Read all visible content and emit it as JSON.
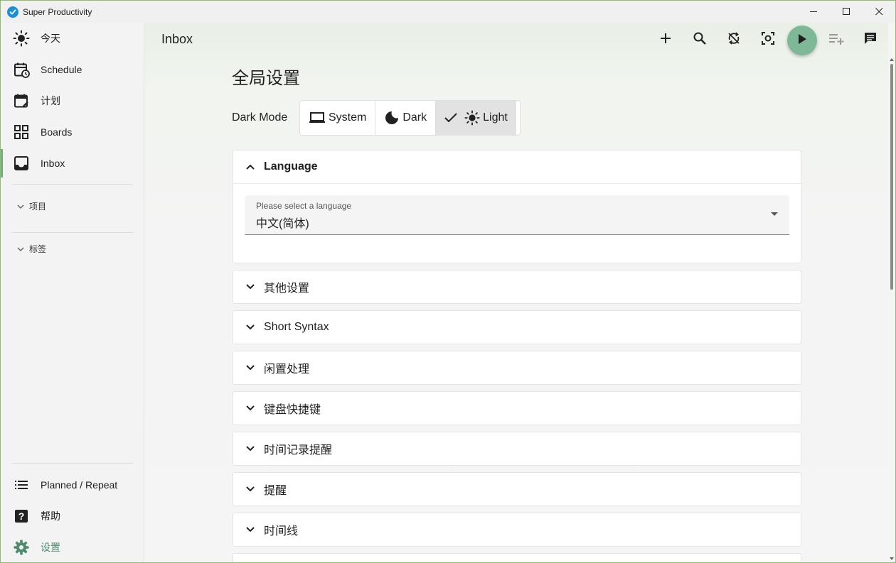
{
  "window": {
    "title": "Super Productivity"
  },
  "sidebar": {
    "items": [
      {
        "label": "今天",
        "icon": "sun-icon"
      },
      {
        "label": "Schedule",
        "icon": "calendar-clock-icon"
      },
      {
        "label": "计划",
        "icon": "calendar-edit-icon"
      },
      {
        "label": "Boards",
        "icon": "grid-icon"
      },
      {
        "label": "Inbox",
        "icon": "inbox-icon",
        "active": true
      }
    ],
    "sections": [
      {
        "label": "项目"
      },
      {
        "label": "标签"
      }
    ],
    "bottom_items": [
      {
        "label": "Planned / Repeat",
        "icon": "list-icon"
      },
      {
        "label": "帮助",
        "icon": "help-icon"
      },
      {
        "label": "设置",
        "icon": "gear-icon",
        "active": true
      }
    ]
  },
  "topbar": {
    "title": "Inbox",
    "actions": [
      "add-icon",
      "search-icon",
      "sync-off-icon",
      "focus-icon",
      "play-icon",
      "add-to-list-icon",
      "comment-icon"
    ]
  },
  "settings": {
    "title": "全局设置",
    "dark_mode": {
      "label": "Dark Mode",
      "options": [
        "System",
        "Dark",
        "Light"
      ],
      "selected": "Light"
    },
    "language_panel": {
      "title": "Language",
      "select_placeholder": "Please select a language",
      "select_value": "中文(简体)"
    },
    "panels": [
      "其他设置",
      "Short Syntax",
      "闲置处理",
      "键盘快捷键",
      "时间记录提醒",
      "提醒",
      "时间线"
    ]
  },
  "colors": {
    "accent": "#7fb897",
    "settings_active": "#4e8b6c",
    "app_logo": "#1a8fd6"
  }
}
